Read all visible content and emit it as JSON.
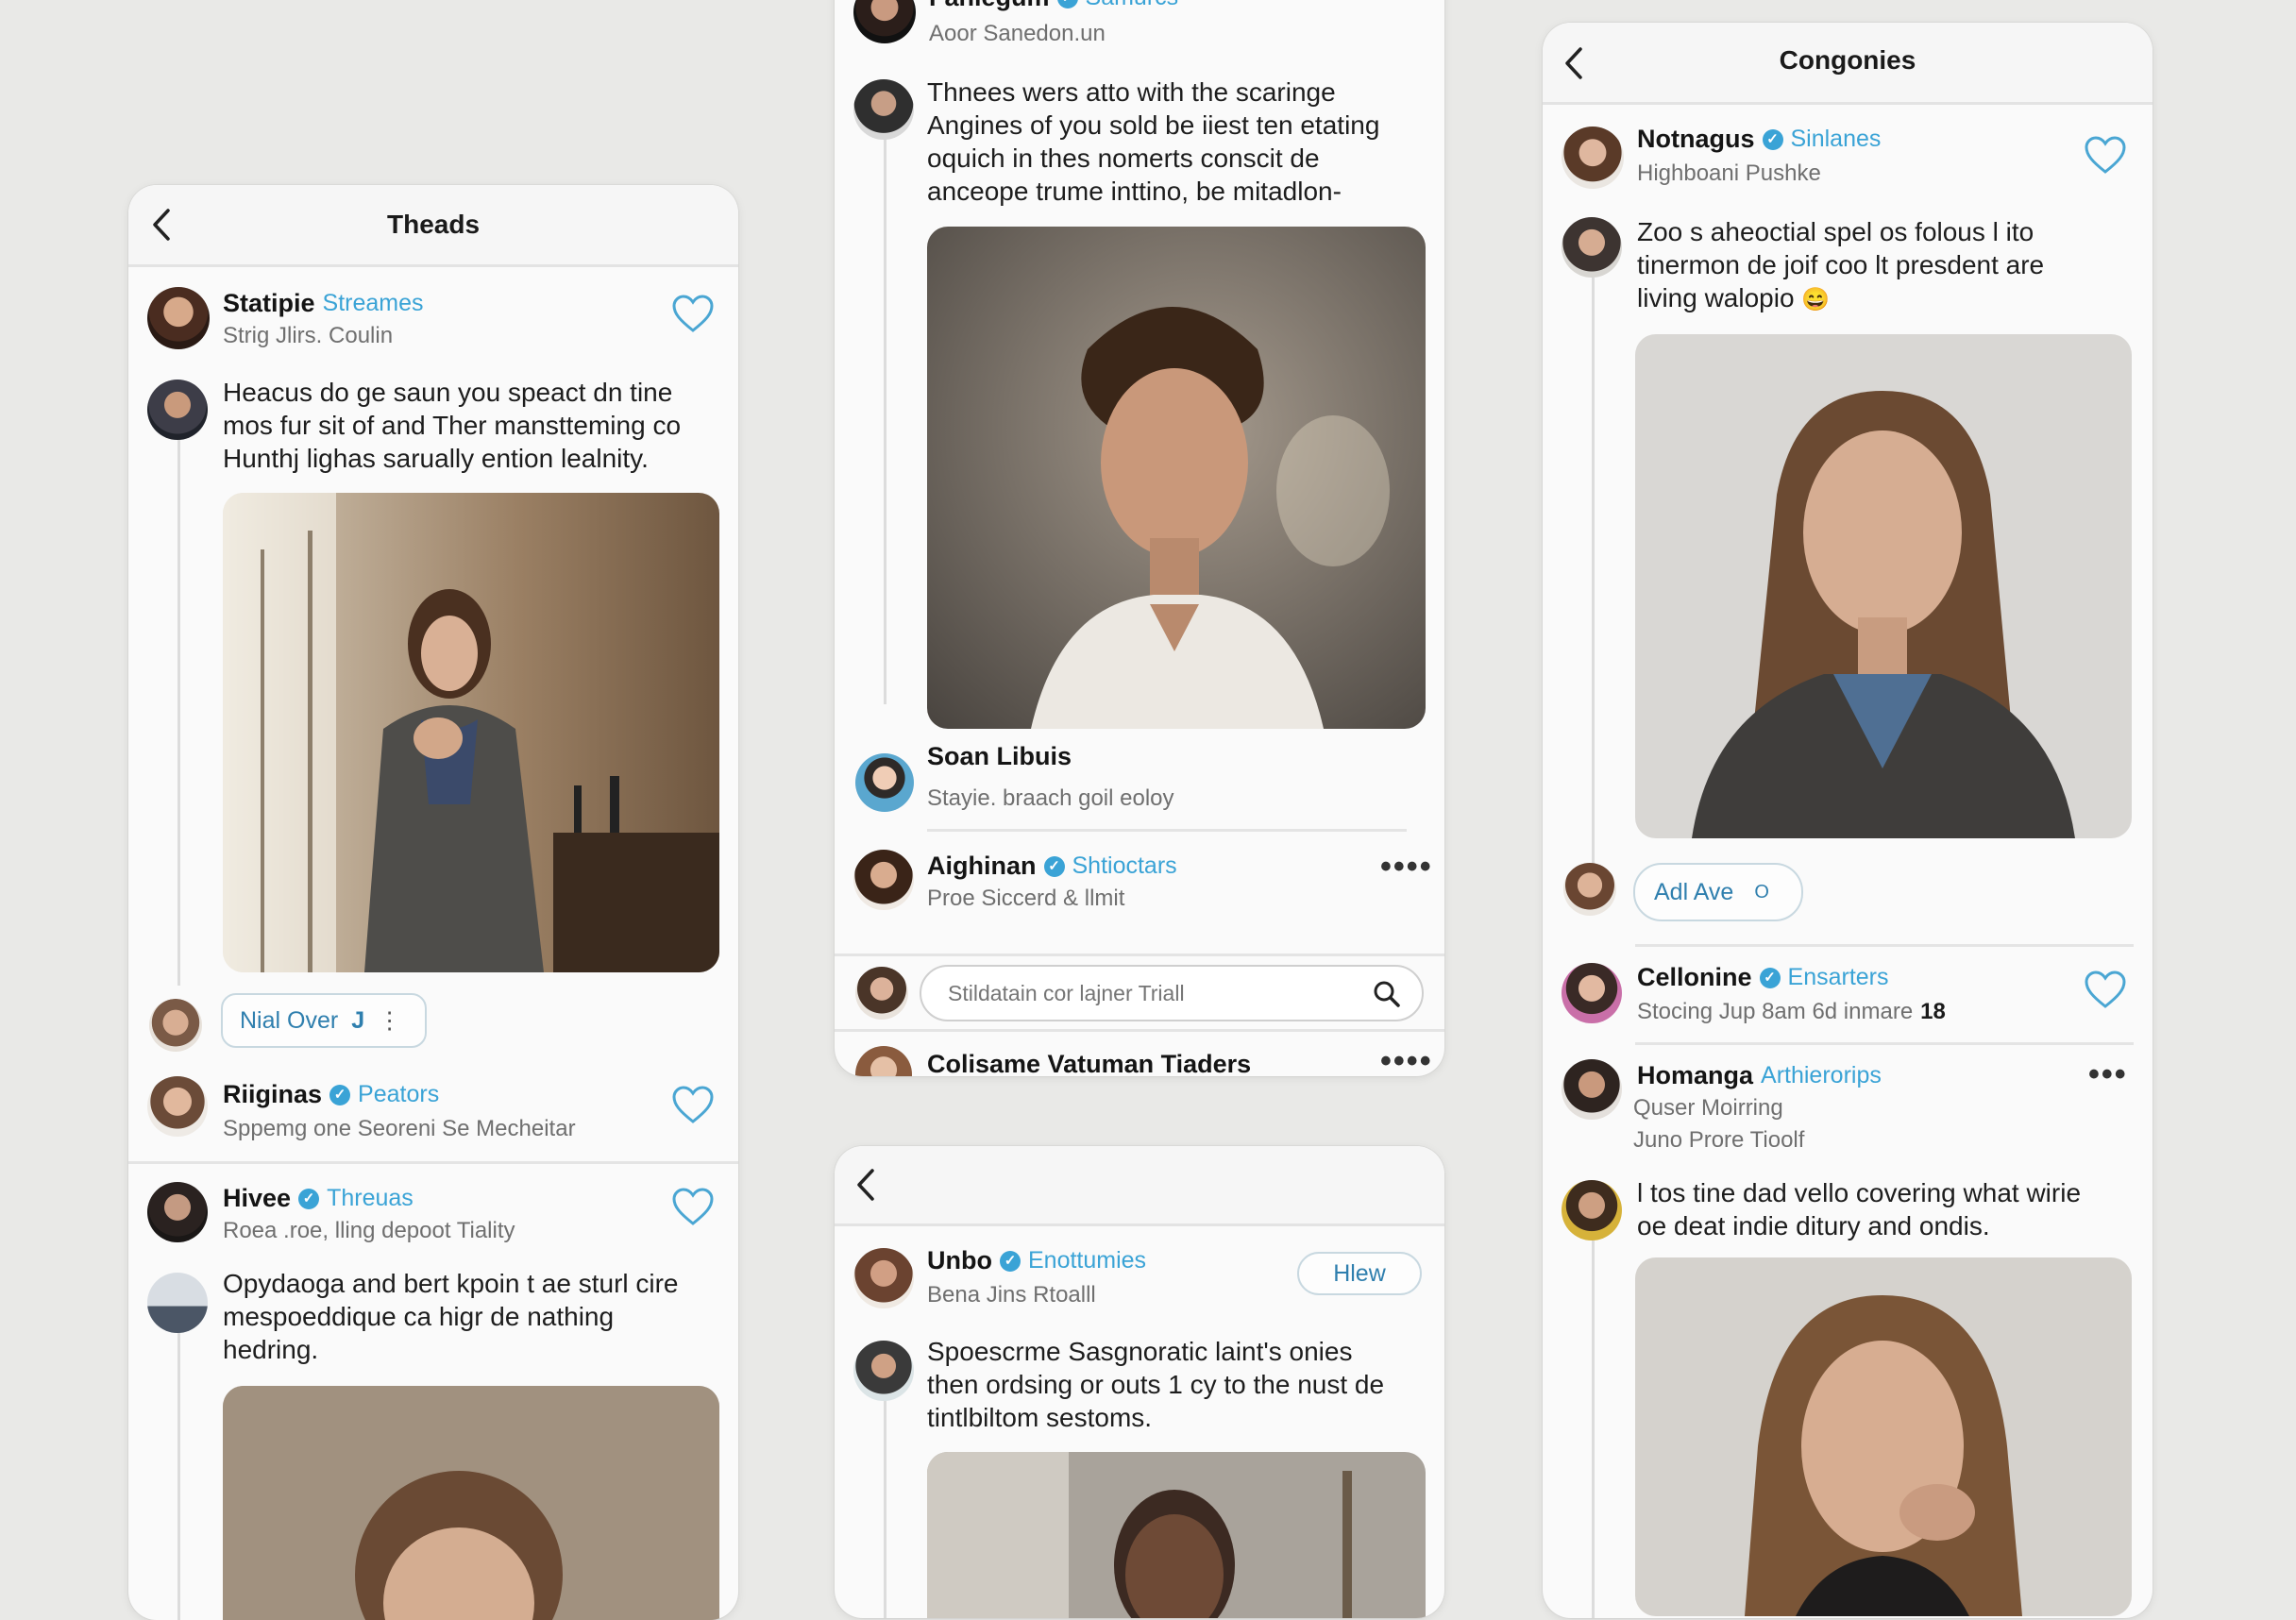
{
  "panel_left": {
    "header": {
      "title": "Theads"
    },
    "post1": {
      "name": "Statipie",
      "handle": "Streames",
      "sub": "Strig Jlirs. Coulin"
    },
    "post2": {
      "text": [
        "Heacus do ge saun you speact dn tine",
        "mos fur sit of and Ther manstteming co",
        "Hunthj lighas sarually ention lealnity."
      ]
    },
    "reply_button": {
      "label": "Nial Over",
      "icon": "J"
    },
    "post3": {
      "name": "Riiginas",
      "handle": "Peators",
      "sub": "Sppemg one Seoreni Se Mecheitar"
    },
    "post4": {
      "name": "Hivee",
      "handle": "Threuas",
      "sub": "Roea .roe, lling depoot Tiality"
    },
    "post5": {
      "text": [
        "Opydaoga and bert kpoin t ae sturl cire",
        "mespoeddique ca higr de nathing",
        "hedring."
      ]
    }
  },
  "panel_mid_top": {
    "post1": {
      "name": "Faniegum",
      "handle": "Samurcs",
      "sub": "Aoor Sanedon.un"
    },
    "post2": {
      "text": [
        "Thnees wers atto with the scaringe",
        "Angines of you sold be iiest ten etating",
        "oquich in thes nomerts conscit de",
        "anceope trume inttino, be mitadlon-"
      ]
    },
    "post3": {
      "name": "Soan Libuis",
      "sub": "Stayie. braach goil eoloy"
    },
    "post4": {
      "name": "Aighinan",
      "handle": "Shtioctars",
      "sub": "Proe Siccerd & llmit",
      "more": "••••"
    },
    "search": {
      "placeholder": "Stildatain cor lajner Triall"
    },
    "post5": {
      "name": "Colisame Vatuman Tiaders",
      "more": "••••"
    }
  },
  "panel_mid_bottom": {
    "post1": {
      "name": "Unbo",
      "handle": "Enottumies",
      "sub": "Bena Jins Rtoalll",
      "action": "Hlew"
    },
    "post2": {
      "text": [
        "Spoescrme Sasgnoratic laint's onies",
        "then ordsing or outs 1 cy to the nust de",
        "tintlbiltom sestoms."
      ]
    }
  },
  "panel_right": {
    "header": {
      "title": "Congonies"
    },
    "post1": {
      "name": "Notnagus",
      "handle": "Sinlanes",
      "sub": "Highboani Pushke"
    },
    "post2": {
      "text": [
        "Zoo s aheoctial spel os folous l ito",
        "tinermon de joif coo lt presdent are",
        "living walopio"
      ],
      "emoji": "😄"
    },
    "add_button": {
      "label": "Adl Ave",
      "icon": "O"
    },
    "post3": {
      "name": "Cellonine",
      "handle": "Ensarters",
      "sub": "Stocing Jup 8am 6d inmare",
      "count": "18"
    },
    "post4": {
      "name": "Homanga",
      "handle": "Arthierorips",
      "sub1": "Quser Moirring",
      "sub2": "Juno Prore Tioolf",
      "more": "•••"
    },
    "post5": {
      "text": [
        "l tos tine dad vello covering what wirie",
        "oe deat indie ditury and ondis."
      ]
    }
  },
  "colors": {
    "accent": "#3aa3d6",
    "text": "#1b1b1b",
    "muted": "#6f6f6f",
    "background": "#e9e9e7",
    "panel": "#fafafa"
  },
  "icons": [
    "back-icon",
    "heart-icon",
    "verified-icon",
    "search-icon",
    "more-icon"
  ]
}
